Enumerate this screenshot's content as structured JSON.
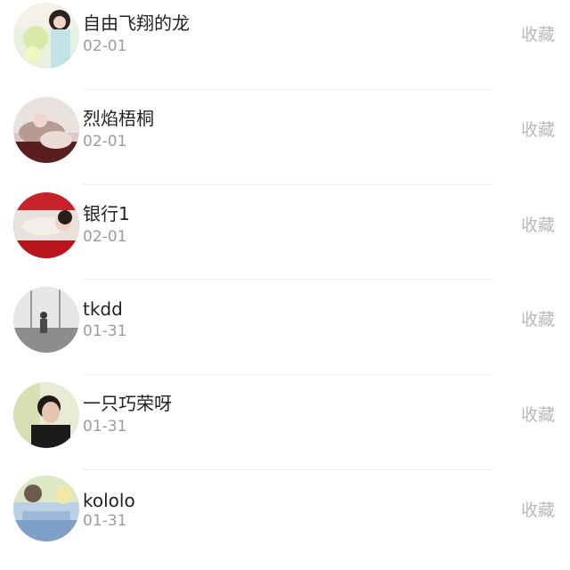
{
  "items": [
    {
      "name": "自由飞翔的龙",
      "date": "02-01",
      "action": "收藏",
      "avatar_icon": "user-avatar-photo"
    },
    {
      "name": "烈焰梧桐",
      "date": "02-01",
      "action": "收藏",
      "avatar_icon": "user-avatar-photo"
    },
    {
      "name": "银行1",
      "date": "02-01",
      "action": "收藏",
      "avatar_icon": "user-avatar-photo"
    },
    {
      "name": "tkdd",
      "date": "01-31",
      "action": "收藏",
      "avatar_icon": "user-avatar-photo"
    },
    {
      "name": "一只巧荣呀",
      "date": "01-31",
      "action": "收藏",
      "avatar_icon": "user-avatar-photo"
    },
    {
      "name": "kololo",
      "date": "01-31",
      "action": "收藏",
      "avatar_icon": "user-avatar-photo"
    }
  ],
  "colors": {
    "name_text": "#222222",
    "date_text": "#9b9b9b",
    "action_text": "#b9b9b9",
    "divider": "#eeeeee"
  }
}
